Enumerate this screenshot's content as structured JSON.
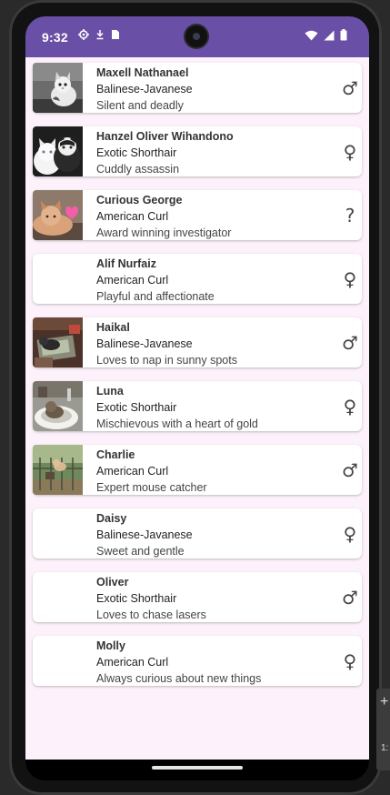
{
  "status_bar": {
    "time": "9:32",
    "left_icons": [
      "settings-gear-icon",
      "download-arrow-icon",
      "sim-card-icon"
    ],
    "right_icons": [
      "wifi-icon",
      "cellular-signal-icon",
      "battery-icon"
    ],
    "background_color": "#6a4fa6"
  },
  "content": {
    "background_color": "#fdf2fb"
  },
  "cats": [
    {
      "name": "Maxell Nathanael",
      "breed": "Balinese-Javanese",
      "description": "Silent and deadly",
      "gender": "♂",
      "gender_icon": "male-symbol-icon",
      "photo": "kitten-bw-photo"
    },
    {
      "name": "Hanzel Oliver Wihandono",
      "breed": "Exotic Shorthair",
      "description": "Cuddly assassin",
      "gender": "♀",
      "gender_icon": "female-symbol-icon",
      "photo": "two-cats-photo"
    },
    {
      "name": "Curious George",
      "breed": "American Curl",
      "description": "Award winning investigator",
      "gender": "?",
      "gender_icon": "unknown-gender-icon",
      "photo": "ginger-cat-heart-photo"
    },
    {
      "name": "Alif Nurfaiz",
      "breed": "American Curl",
      "description": "Playful and affectionate",
      "gender": "♀",
      "gender_icon": "female-symbol-icon",
      "photo": ""
    },
    {
      "name": "Haikal",
      "breed": "Balinese-Javanese",
      "description": "Loves to nap in sunny spots",
      "gender": "♂",
      "gender_icon": "male-symbol-icon",
      "photo": "cat-on-desk-photo"
    },
    {
      "name": "Luna",
      "breed": "Exotic Shorthair",
      "description": "Mischievous with a heart of gold",
      "gender": "♀",
      "gender_icon": "female-symbol-icon",
      "photo": "cat-in-sink-photo"
    },
    {
      "name": "Charlie",
      "breed": "American Curl",
      "description": "Expert mouse catcher",
      "gender": "♂",
      "gender_icon": "male-symbol-icon",
      "photo": "cat-outdoors-fence-photo"
    },
    {
      "name": "Daisy",
      "breed": "Balinese-Javanese",
      "description": "Sweet and gentle",
      "gender": "♀",
      "gender_icon": "female-symbol-icon",
      "photo": ""
    },
    {
      "name": "Oliver",
      "breed": "Exotic Shorthair",
      "description": "Loves to chase lasers",
      "gender": "♂",
      "gender_icon": "male-symbol-icon",
      "photo": ""
    },
    {
      "name": "Molly",
      "breed": "American Curl",
      "description": "Always curious about new things",
      "gender": "♀",
      "gender_icon": "female-symbol-icon",
      "photo": ""
    }
  ],
  "side_tool": {
    "plus": "+",
    "number": "1:"
  }
}
